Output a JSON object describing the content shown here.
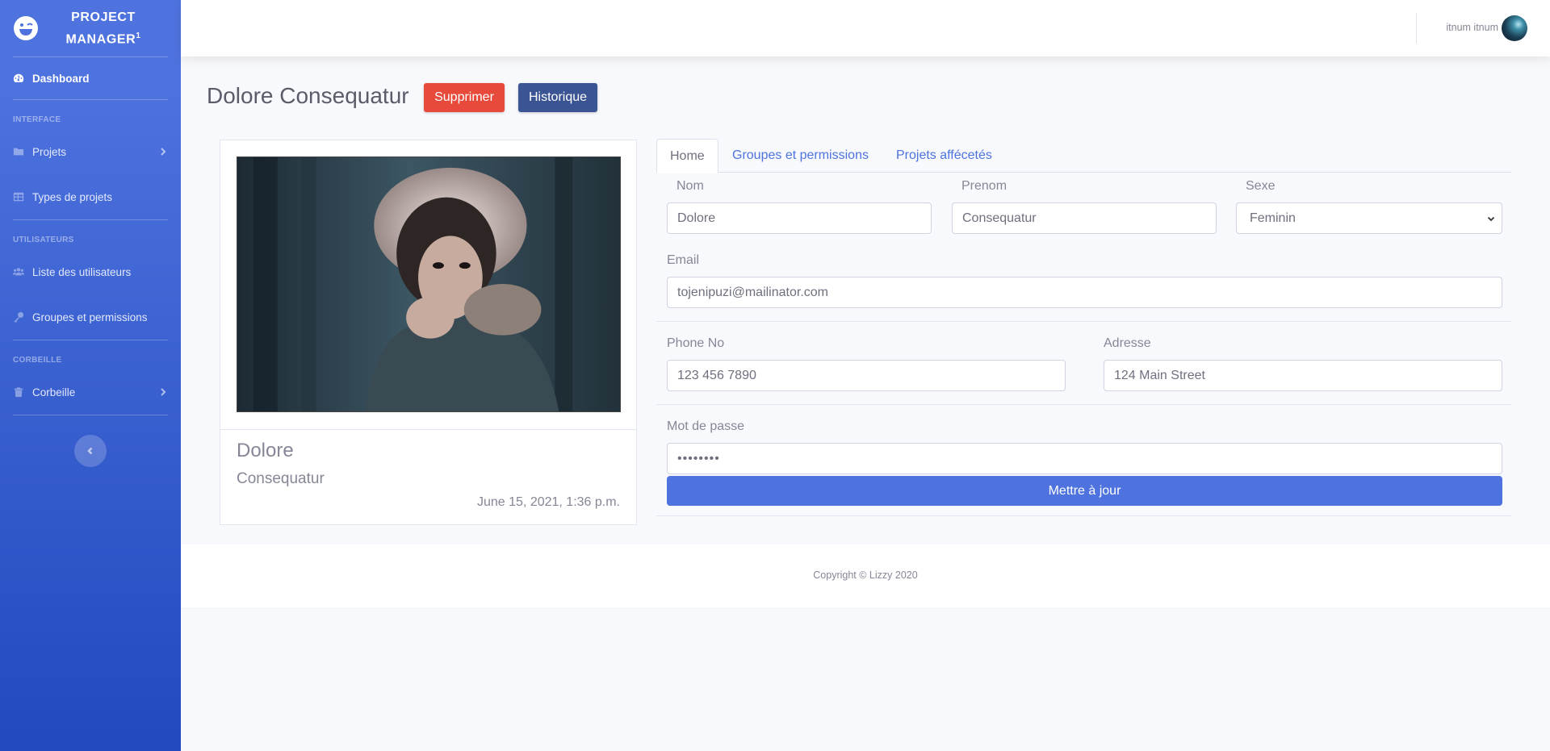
{
  "brand": {
    "line1": "Project",
    "line2": "Manager",
    "sup": "1",
    "icon": "laugh-wink-icon"
  },
  "sidebar": {
    "dashboard": {
      "label": "Dashboard",
      "icon": "tachometer-icon"
    },
    "heading_interface": "Interface",
    "projets": {
      "label": "Projets",
      "icon": "folder-icon"
    },
    "types": {
      "label": "Types de projets",
      "icon": "table-icon"
    },
    "heading_users": "Utilisateurs",
    "users": {
      "label": "Liste des utilisateurs",
      "icon": "users-icon"
    },
    "groups": {
      "label": "Groupes et permissions",
      "icon": "key-icon"
    },
    "heading_trash": "Corbeille",
    "trash": {
      "label": "Corbeille",
      "icon": "trash-icon"
    }
  },
  "topbar": {
    "user_name": "itnum itnum"
  },
  "page": {
    "title": "Dolore Consequatur",
    "delete_label": "Supprimer",
    "history_label": "Historique"
  },
  "profile": {
    "first_name": "Dolore",
    "last_name": "Consequatur",
    "date": "June 15, 2021, 1:36 p.m."
  },
  "tabs": [
    "Home",
    "Groupes et permissions",
    "Projets affécetés"
  ],
  "form": {
    "nom_label": "Nom",
    "nom_value": "Dolore",
    "prenom_label": "Prenom",
    "prenom_value": "Consequatur",
    "sexe_label": "Sexe",
    "sexe_value": "Feminin",
    "email_label": "Email",
    "email_value": "tojenipuzi@mailinator.com",
    "phone_label": "Phone No",
    "phone_placeholder": "123 456 7890",
    "adresse_label": "Adresse",
    "adresse_placeholder": "124 Main Street",
    "password_label": "Mot de passe",
    "password_value": "••••••••",
    "submit_label": "Mettre à jour"
  },
  "footer": {
    "copyright": "Copyright © Lizzy 2020"
  },
  "colors": {
    "primary": "#4e73df",
    "danger": "#e74a3b",
    "history": "#3a5494"
  }
}
